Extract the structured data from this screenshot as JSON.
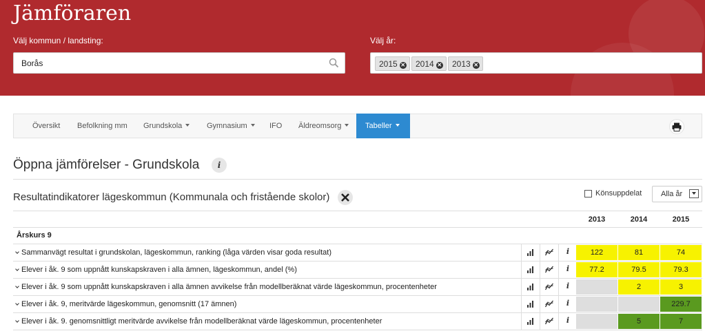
{
  "app": {
    "title": "Jämföraren"
  },
  "filters": {
    "municipality_label": "Välj kommun / landsting:",
    "municipality_value": "Borås",
    "year_label": "Välj år:",
    "years": [
      "2015",
      "2014",
      "2013"
    ]
  },
  "nav": {
    "items": [
      {
        "label": "Översikt"
      },
      {
        "label": "Befolkning mm"
      },
      {
        "label": "Grundskola",
        "dropdown": true
      },
      {
        "label": "Gymnasium",
        "dropdown": true
      },
      {
        "label": "IFO"
      },
      {
        "label": "Äldreomsorg",
        "dropdown": true
      }
    ],
    "active": {
      "label": "Tabeller",
      "dropdown": true
    }
  },
  "page": {
    "title": "Öppna jämförelser - Grundskola"
  },
  "section": {
    "title": "Resultatindikatorer lägeskommun (Kommunala och fristående skolor)",
    "gender_split_label": "Könsuppdelat",
    "gender_split_checked": false,
    "year_select": "Alla år"
  },
  "table": {
    "columns": [
      "2013",
      "2014",
      "2015"
    ],
    "group": "Årskurs 9",
    "rows": [
      {
        "label": "Sammanvägt resultat i grundskolan, lägeskommun, ranking (låga värden visar goda resultat)",
        "values": [
          "122",
          "81",
          "74"
        ],
        "colors": [
          "#f7f200",
          "#f7f200",
          "#f7f200"
        ]
      },
      {
        "label": "Elever i åk. 9 som uppnått kunskapskraven i alla ämnen, lägeskommun, andel (%)",
        "values": [
          "77.2",
          "79.5",
          "79.3"
        ],
        "colors": [
          "#f7f200",
          "#f7f200",
          "#f7f200"
        ]
      },
      {
        "label": "Elever i åk. 9 som uppnått kunskapskraven i alla ämnen avvikelse från modellberäknat värde lägeskommun, procentenheter",
        "values": [
          "",
          "2",
          "3"
        ],
        "colors": [
          "#dedede",
          "#f7f200",
          "#f7f200"
        ]
      },
      {
        "label": "Elever i åk. 9, meritvärde lägeskommun, genomsnitt (17 ämnen)",
        "values": [
          "",
          "",
          "229.7"
        ],
        "colors": [
          "#dedede",
          "#dedede",
          "#5a9a1f"
        ]
      },
      {
        "label": "Elever i åk. 9. genomsnittligt meritvärde avvikelse från modellberäknat värde lägeskommun, procentenheter",
        "values": [
          "",
          "5",
          "7"
        ],
        "colors": [
          "#dedede",
          "#5a9a1f",
          "#5a9a1f"
        ]
      }
    ]
  }
}
